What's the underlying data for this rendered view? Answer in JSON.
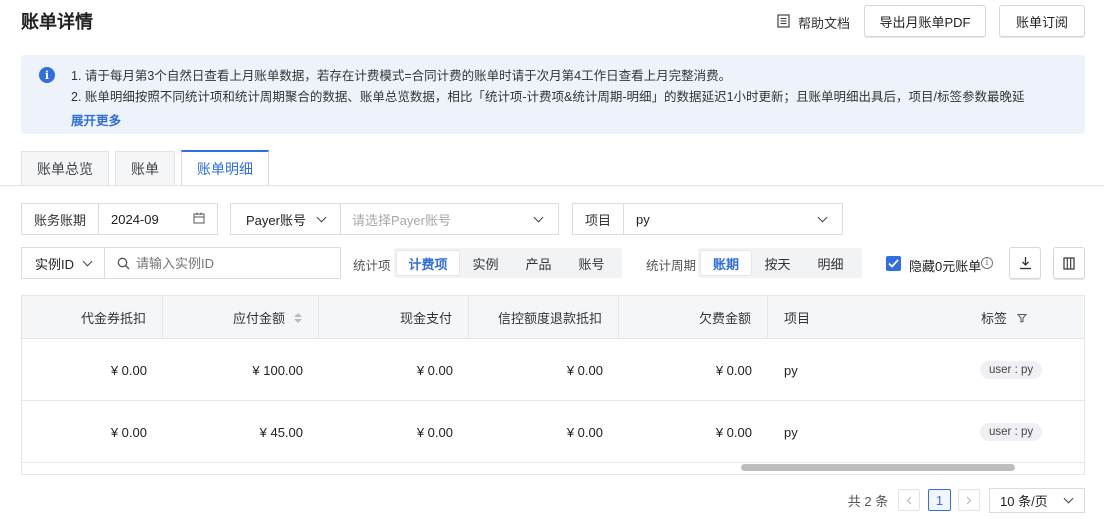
{
  "header": {
    "title": "账单详情",
    "help_doc": "帮助文档",
    "export_pdf": "导出月账单PDF",
    "subscribe": "账单订阅"
  },
  "notice": {
    "line1": "1. 请于每月第3个自然日查看上月账单数据，若存在计费模式=合同计费的账单时请于次月第4工作日查看上月完整消费。",
    "line2": "2. 账单明细按照不同统计项和统计周期聚合的数据、账单总览数据，相比「统计项-计费项&统计周期-明细」的数据延迟1小时更新；且账单明细出具后，项目/标签参数最晚延",
    "more": "展开更多"
  },
  "tabs": [
    {
      "label": "账单总览"
    },
    {
      "label": "账单"
    },
    {
      "label": "账单明细"
    }
  ],
  "filters": {
    "period_label": "账务账期",
    "period_value": "2024-09",
    "payer_select": "Payer账号",
    "payer_placeholder": "请选择Payer账号",
    "project_label": "项目",
    "project_value": "py",
    "instance_select": "实例ID",
    "instance_placeholder": "请输入实例ID",
    "stat_item_label": "统计项",
    "stat_items": [
      "计费项",
      "实例",
      "产品",
      "账号"
    ],
    "stat_period_label": "统计周期",
    "stat_periods": [
      "账期",
      "按天",
      "明细"
    ],
    "hide_zero_label": "隐藏0元账单"
  },
  "table": {
    "columns": [
      "代金券抵扣",
      "应付金额",
      "现金支付",
      "信控额度退款抵扣",
      "欠费金额",
      "项目",
      "标签"
    ],
    "rows": [
      {
        "voucher": "¥ 0.00",
        "payable": "¥ 100.00",
        "cash": "¥ 0.00",
        "credit": "¥ 0.00",
        "arrears": "¥ 0.00",
        "project": "py",
        "tag": "user : py"
      },
      {
        "voucher": "¥ 0.00",
        "payable": "¥ 45.00",
        "cash": "¥ 0.00",
        "credit": "¥ 0.00",
        "arrears": "¥ 0.00",
        "project": "py",
        "tag": "user : py"
      }
    ]
  },
  "pagination": {
    "total": "共 2 条",
    "current_page": "1",
    "page_size": "10 条/页"
  },
  "colors": {
    "accent": "#2f6fe0",
    "notice_bg": "#eef3fb"
  }
}
